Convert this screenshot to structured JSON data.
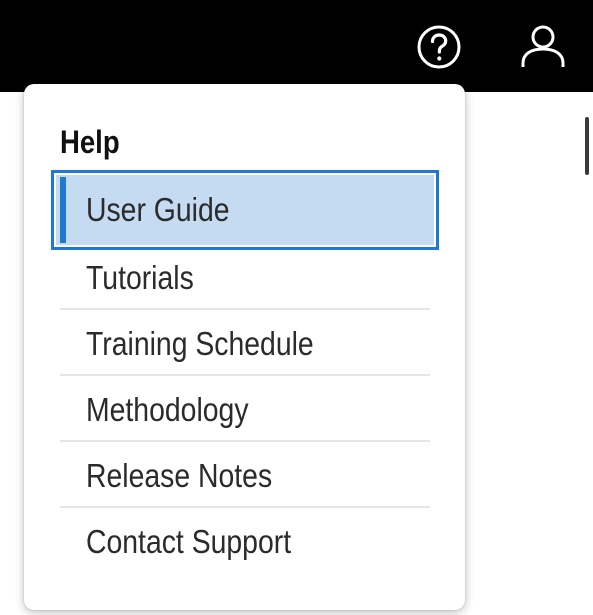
{
  "topbar": {
    "icons": [
      "help-icon",
      "user-icon"
    ]
  },
  "help_menu": {
    "title": "Help",
    "items": [
      {
        "label": "User Guide",
        "selected": true
      },
      {
        "label": "Tutorials",
        "selected": false
      },
      {
        "label": "Training Schedule",
        "selected": false
      },
      {
        "label": "Methodology",
        "selected": false
      },
      {
        "label": "Release Notes",
        "selected": false
      },
      {
        "label": "Contact Support",
        "selected": false
      }
    ]
  },
  "colors": {
    "topbar": "#000000",
    "selected_background": "#c5dbf2",
    "selected_border": "#1f78d1",
    "divider": "#e6e6e6",
    "text": "#2b2b2b"
  }
}
